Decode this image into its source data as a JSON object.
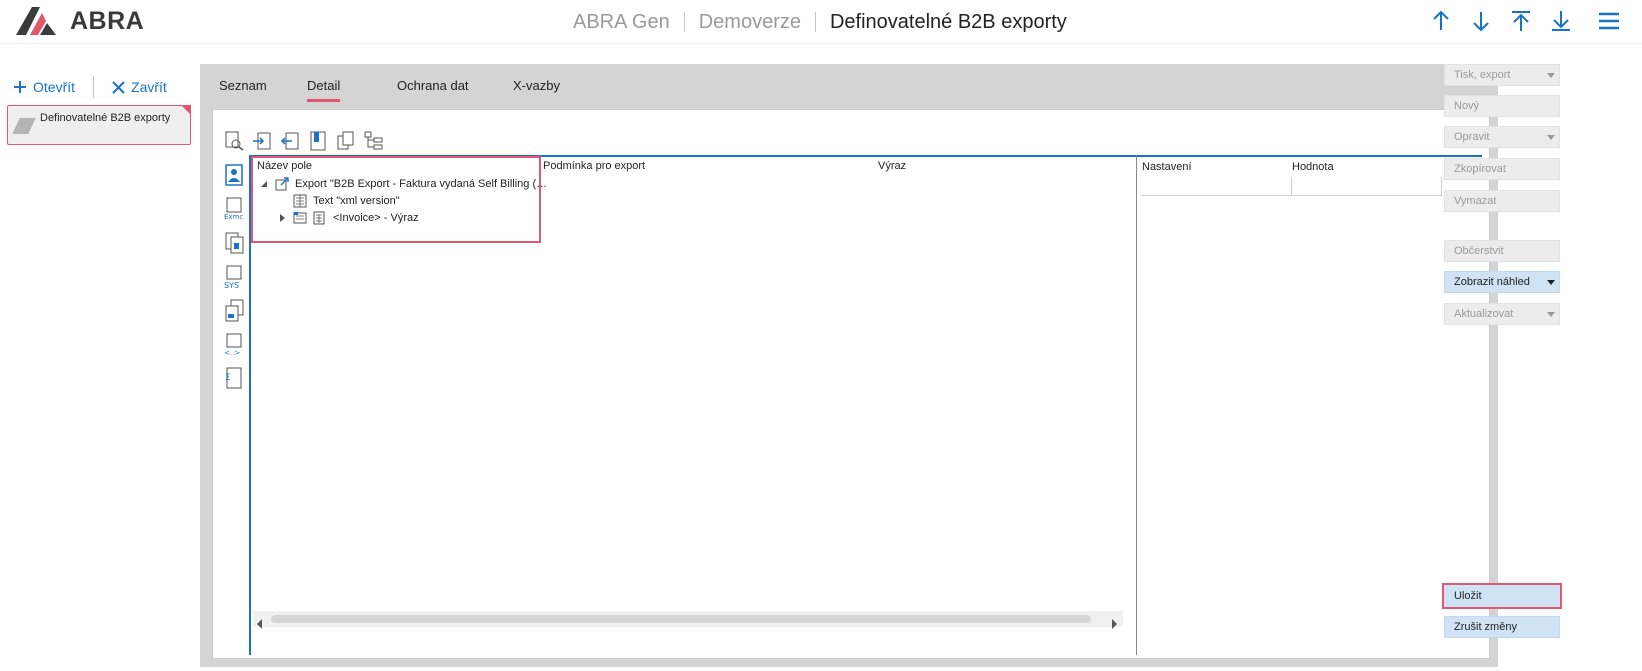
{
  "header": {
    "logo_text": "ABRA",
    "breadcrumbs": [
      "ABRA Gen",
      "Demoverze",
      "Definovatelné B2B exporty"
    ]
  },
  "left_panel": {
    "open_label": "Otevřít",
    "close_label": "Zavřít",
    "doc_card_label": "Definovatelné B2B exporty"
  },
  "tabs": [
    {
      "label": "Seznam",
      "active": false
    },
    {
      "label": "Detail",
      "active": true
    },
    {
      "label": "Ochrana dat",
      "active": false
    },
    {
      "label": "X-vazby",
      "active": false
    }
  ],
  "tree": {
    "columns": [
      "Název pole",
      "Podmínka pro export",
      "Výraz"
    ],
    "nodes": [
      {
        "label": "Export \"B2B Export - Faktura vydaná Self Billing (…",
        "expanded": true
      },
      {
        "label": "Text \"xml version\""
      },
      {
        "label": "<Invoice> - Výraz",
        "expanded": false
      }
    ]
  },
  "properties": {
    "columns": [
      "Nastavení",
      "Hodnota"
    ]
  },
  "actions": {
    "print_export": "Tisk, export",
    "new": "Nový",
    "edit": "Opravit",
    "copy": "Zkopírovat",
    "delete": "Vymazat",
    "refresh": "Občerstvit",
    "preview": "Zobrazit náhled",
    "update": "Aktualizovat",
    "save": "Uložit",
    "cancel": "Zrušit změny"
  },
  "colors": {
    "accent_blue": "#1873c8",
    "highlight_red": "#e0576e",
    "gray_bg": "#d4d4d4"
  },
  "icons": [
    "arrow-up-icon",
    "arrow-down-icon",
    "arrow-to-top-icon",
    "arrow-to-bottom-icon",
    "menu-icon"
  ]
}
